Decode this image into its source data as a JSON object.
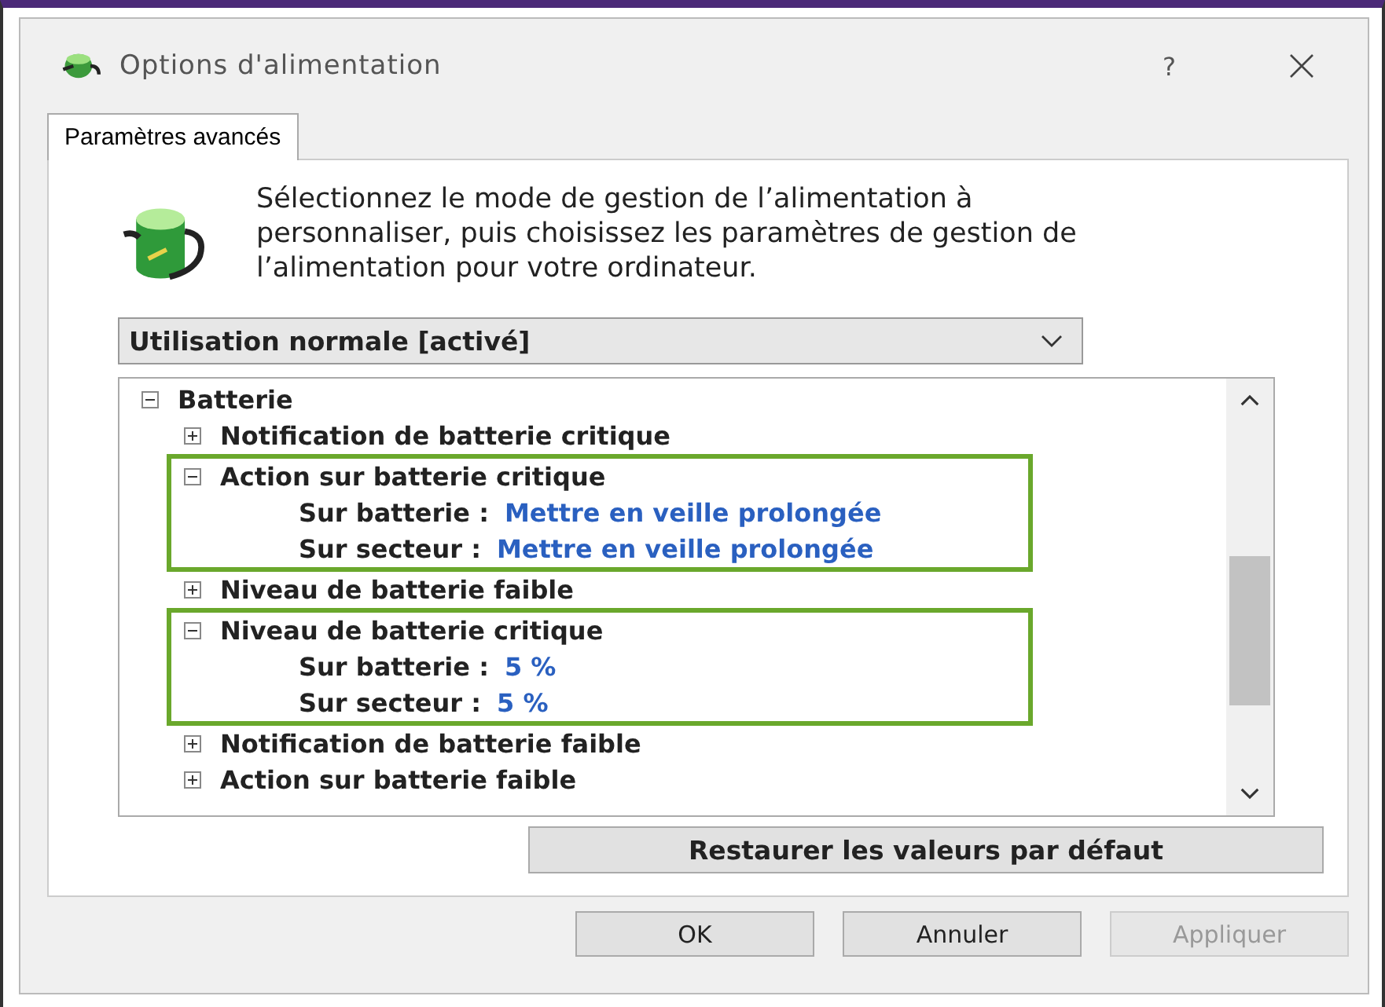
{
  "window": {
    "title": "Options d'alimentation",
    "help": "?"
  },
  "tabs": [
    {
      "label": "Paramètres avancés",
      "selected": true
    }
  ],
  "description": "Sélectionnez le mode de gestion de l’alimentation à personnaliser, puis choisissez les paramètres de gestion de l’alimentation pour votre ordinateur.",
  "plan_dropdown": {
    "value": "Utilisation normale [activé]"
  },
  "tree": [
    {
      "label": "Batterie",
      "expanded": true,
      "children": [
        {
          "label": "Notification de batterie critique",
          "expanded": false,
          "highlighted": false
        },
        {
          "label": "Action sur batterie critique",
          "expanded": true,
          "highlighted": true,
          "children": [
            {
              "kind": "setting",
              "label": "Sur batterie :",
              "value": "Mettre en veille prolongée"
            },
            {
              "kind": "setting",
              "label": "Sur secteur :",
              "value": "Mettre en veille prolongée"
            }
          ]
        },
        {
          "label": "Niveau de batterie faible",
          "expanded": false,
          "highlighted": false
        },
        {
          "label": "Niveau de batterie critique",
          "expanded": true,
          "highlighted": true,
          "children": [
            {
              "kind": "setting",
              "label": "Sur batterie :",
              "value": "5  %"
            },
            {
              "kind": "setting",
              "label": "Sur secteur :",
              "value": "5  %"
            }
          ]
        },
        {
          "label": "Notification de batterie faible",
          "expanded": false,
          "highlighted": false
        },
        {
          "label": "Action sur batterie faible",
          "expanded": false,
          "highlighted": false
        }
      ]
    }
  ],
  "restore_button": "Restaurer les valeurs par défaut",
  "buttons": [
    {
      "label": "OK",
      "disabled": false
    },
    {
      "label": "Annuler",
      "disabled": false
    },
    {
      "label": "Appliquer",
      "disabled": true
    }
  ]
}
